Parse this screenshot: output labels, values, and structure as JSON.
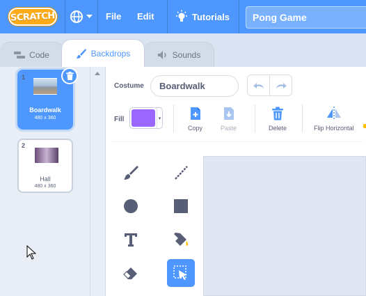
{
  "menubar": {
    "logo": "SCRATCH",
    "file": "File",
    "edit": "Edit",
    "tutorials": "Tutorials",
    "project_title": "Pong Game",
    "color": "#4d97ff"
  },
  "tabs": [
    {
      "label": "Code",
      "icon": "code-icon"
    },
    {
      "label": "Backdrops",
      "icon": "brush-icon"
    },
    {
      "label": "Sounds",
      "icon": "speaker-icon"
    }
  ],
  "backdrops": [
    {
      "number": "1",
      "name": "Boardwalk",
      "size": "480 x 360",
      "selected": true
    },
    {
      "number": "2",
      "name": "Hall",
      "size": "480 x 360",
      "selected": false
    }
  ],
  "editor": {
    "costume_label": "Costume",
    "costume_name": "Boardwalk",
    "fill_label": "Fill",
    "fill_color": "#9966ff",
    "copy": "Copy",
    "paste": "Paste",
    "delete": "Delete",
    "flip_horizontal": "Flip Horizontal"
  }
}
